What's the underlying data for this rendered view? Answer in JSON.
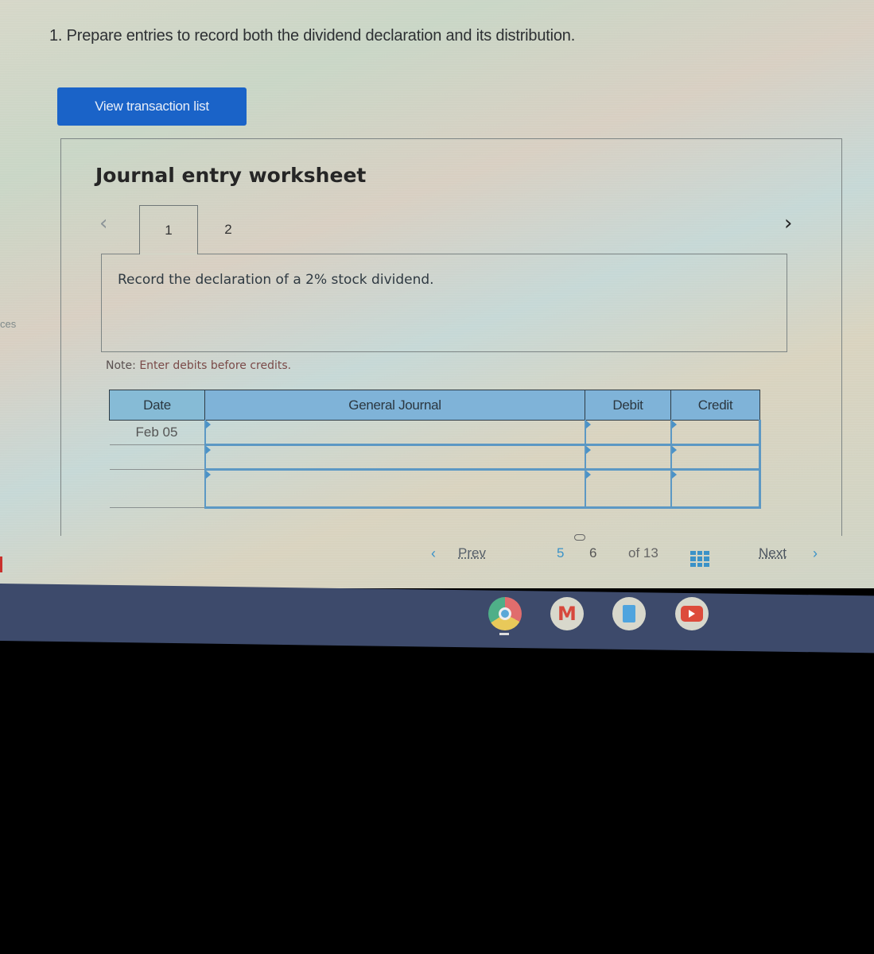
{
  "side_text": "ces",
  "question": "1. Prepare entries to record both the dividend declaration and its distribution.",
  "view_transaction_button": "View transaction list",
  "worksheet": {
    "title": "Journal entry worksheet",
    "prev_icon": "chevron-left-icon",
    "next_icon": "chevron-right-icon",
    "tabs": [
      {
        "label": "1",
        "active": true
      },
      {
        "label": "2",
        "active": false
      }
    ],
    "task": "Record the declaration of a 2% stock dividend.",
    "note_label": "Note:",
    "note_text": "Enter debits before credits."
  },
  "journal": {
    "columns": [
      "Date",
      "General Journal",
      "Debit",
      "Credit"
    ],
    "rows": [
      {
        "date": "Feb 05",
        "account": "",
        "debit": "",
        "credit": ""
      },
      {
        "date": "",
        "account": "",
        "debit": "",
        "credit": ""
      },
      {
        "date": "",
        "account": "",
        "debit": "",
        "credit": ""
      }
    ]
  },
  "pagination": {
    "prev_label": "Prev",
    "prev_icon": "chevron-left-icon",
    "pages": [
      "5",
      "6"
    ],
    "current_page": "5",
    "of_total": "of 13",
    "grid_icon": "grid-icon",
    "link_icon": "link-icon",
    "next_label": "Next",
    "next_icon": "chevron-right-icon"
  },
  "shelf": {
    "apps": [
      "Chrome",
      "Gmail",
      "Docs",
      "YouTube"
    ]
  },
  "colors": {
    "button_blue": "#1a63c8",
    "header_blue": "#7fb3d8",
    "accent_blue": "#3b92c8",
    "shelf": "#3d4a6b"
  }
}
